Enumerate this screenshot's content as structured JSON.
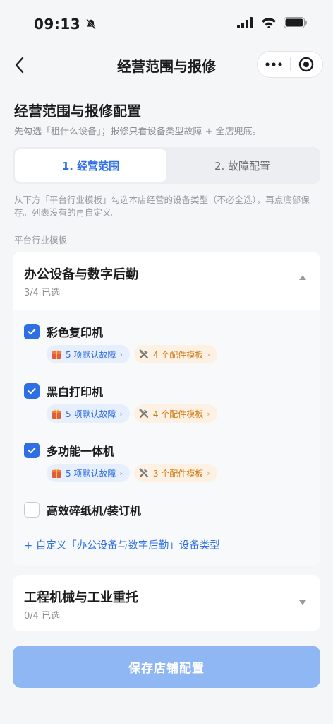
{
  "status_bar": {
    "time": "09:13"
  },
  "nav": {
    "title": "经营范围与报修"
  },
  "heading": {
    "title": "经营范围与报修配置",
    "subtitle": "先勾选「租什么设备」；报修只看设备类型故障 + 全店兜底。"
  },
  "tabs": [
    {
      "label": "1. 经营范围",
      "active": true
    },
    {
      "label": "2. 故障配置",
      "active": false
    }
  ],
  "hint": "从下方「平台行业模板」勾选本店经营的设备类型（不必全选），再点底部保存。列表没有的再自定义。",
  "section_label": "平台行业模板",
  "categories": [
    {
      "title": "办公设备与数字后勤",
      "count": "3/4 已选",
      "expanded": true,
      "items": [
        {
          "name": "彩色复印机",
          "checked": true,
          "fault_tag": "5 项默认故障",
          "part_tag": "4 个配件模板"
        },
        {
          "name": "黑白打印机",
          "checked": true,
          "fault_tag": "5 项默认故障",
          "part_tag": "4 个配件模板"
        },
        {
          "name": "多功能一体机",
          "checked": true,
          "fault_tag": "5 项默认故障",
          "part_tag": "3 个配件模板"
        },
        {
          "name": "高效碎纸机/装订机",
          "checked": false
        }
      ],
      "custom_link": "+ 自定义「办公设备与数字后勤」设备类型"
    },
    {
      "title": "工程机械与工业重托",
      "count": "0/4 已选",
      "expanded": false
    }
  ],
  "save_button": "保存店铺配置",
  "colors": {
    "accent": "#2f6fe4",
    "save_disabled": "#8fb7f3",
    "part_tag": "#d07a16"
  }
}
